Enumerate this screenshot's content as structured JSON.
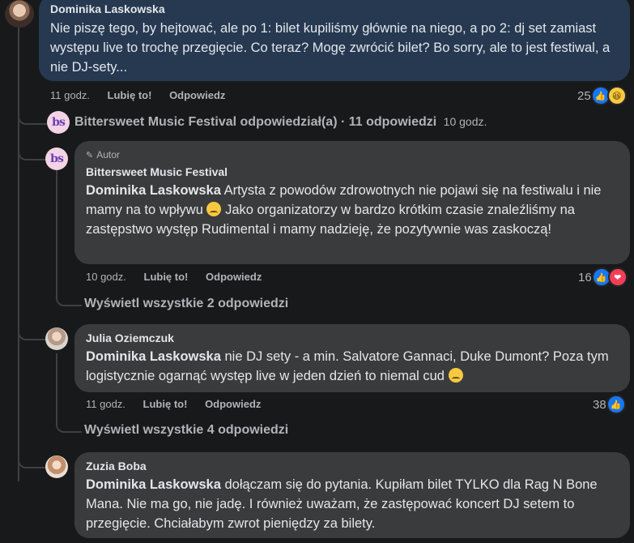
{
  "comments": [
    {
      "author": "Dominika Laskowska",
      "text": "Nie piszę tego, by hejtować, ale po 1: bilet kupiliśmy głównie na niego, a po 2: dj set zamiast występu live to trochę przegięcie. Co teraz? Mogę zwrócić bilet? Bo sorry, ale to jest festiwal, a nie DJ-sety...",
      "time": "11 godz.",
      "like": "Lubię to!",
      "reply": "Odpowiedz",
      "reactions": "25"
    }
  ],
  "page_reply": {
    "summary": "Bittersweet Music Festival odpowiedział(a) · 11 odpowiedzi",
    "time": "10 godz."
  },
  "reply1": {
    "badge": "Autor",
    "author": "Bittersweet Music Festival",
    "mention": "Dominika Laskowska",
    "text": " Artysta z powodów zdrowotnych nie pojawi się na festiwalu i nie mamy na to wpływu",
    "text2": " Jako organizatorzy w bardzo krótkim czasie znaleźliśmy na zastępstwo występ Rudimental i mamy nadzieję, że pozytywnie was zaskoczą!",
    "time": "10 godz.",
    "like": "Lubię to!",
    "reply": "Odpowiedz",
    "reactions": "16",
    "view_all": "Wyświetl wszystkie 2 odpowiedzi"
  },
  "reply2": {
    "author": "Julia Oziemczuk",
    "mention": "Dominika Laskowska",
    "text": " nie DJ sety - a min. Salvatore Gannaci, Duke Dumont? Poza tym logistycznie ogarnąć występ live w jeden dzień to niemal cud",
    "time": "11 godz.",
    "like": "Lubię to!",
    "reply": "Odpowiedz",
    "reactions": "38",
    "view_all": "Wyświetl wszystkie 4 odpowiedzi"
  },
  "reply3": {
    "author": "Zuzia Boba",
    "mention": "Dominika Laskowska",
    "text": " dołączam się do pytania. Kupiłam bilet TYLKO dla Rag N Bone Mana. Nie ma go, nie jadę. I również uważam, że zastępować koncert DJ setem to przegięcie. Chciałabym zwrot pieniędzy za bilety."
  }
}
